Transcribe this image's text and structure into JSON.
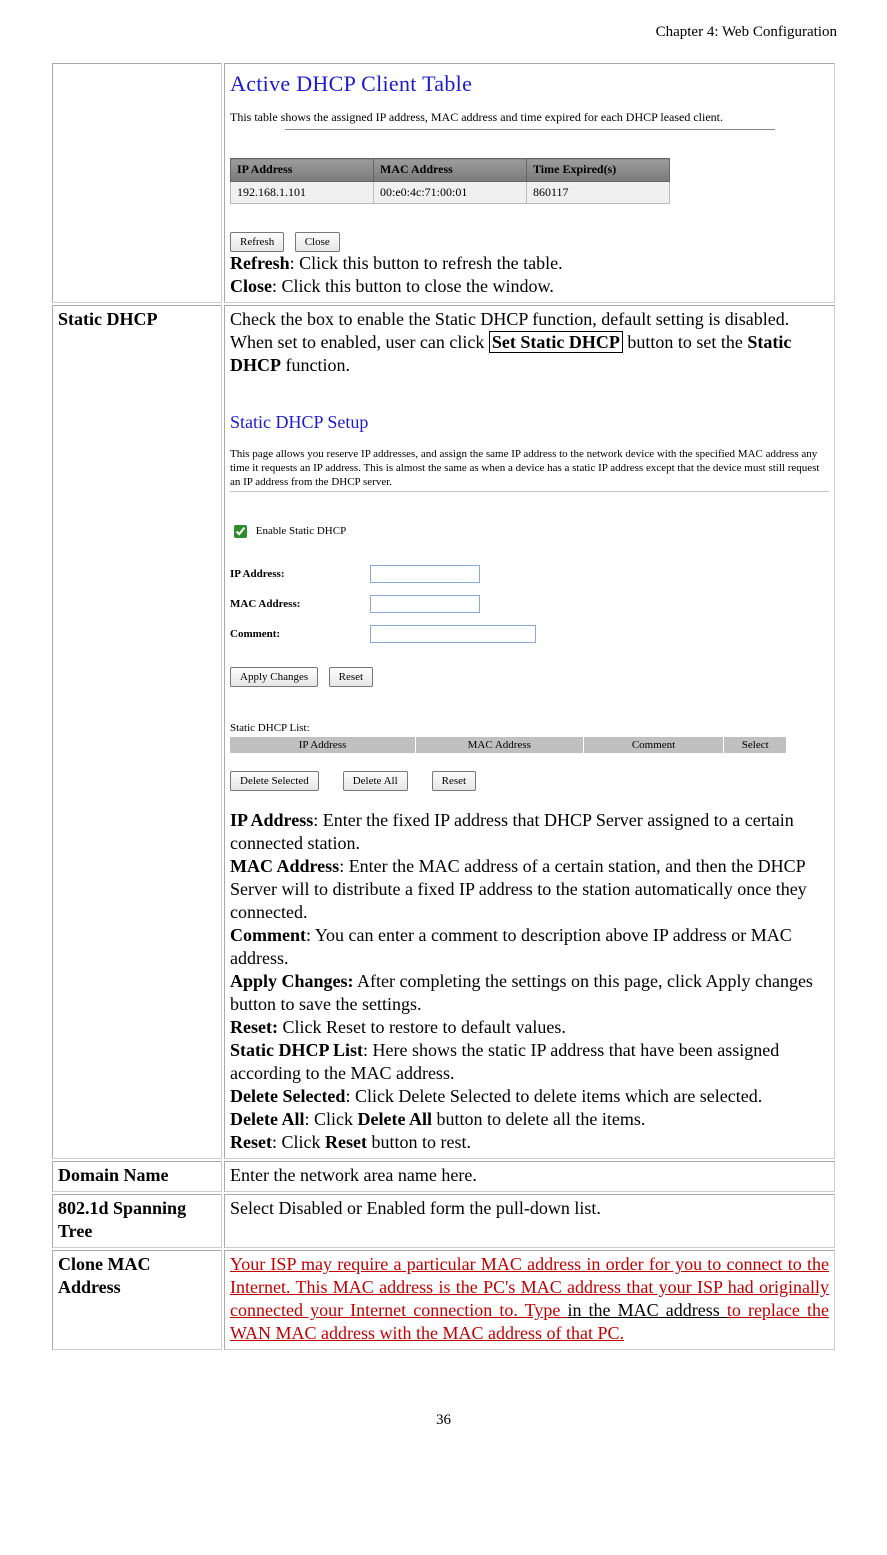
{
  "chapter_header": "Chapter 4: Web Configuration",
  "page_number": "36",
  "row_active": {
    "screenshot": {
      "title": "Active DHCP Client Table",
      "description": "This table shows the assigned IP address, MAC address and time expired for each DHCP leased client.",
      "headers": {
        "ip": "IP Address",
        "mac": "MAC Address",
        "time": "Time Expired(s)"
      },
      "data": {
        "ip": "192.168.1.101",
        "mac": "00:e0:4c:71:00:01",
        "time": "860117"
      },
      "btn_refresh": "Refresh",
      "btn_close": "Close"
    },
    "desc_refresh_b": "Refresh",
    "desc_refresh": ": Click this button to refresh the table.",
    "desc_close_b": "Close",
    "desc_close": ": Click this button to close the window."
  },
  "row_static": {
    "label": "Static DHCP",
    "intro_1": "Check the box to enable the Static DHCP function, default setting is disabled. When set to enabled, user can click ",
    "intro_box": "Set Static DHCP",
    "intro_2": " button to set the ",
    "intro_b": "Static DHCP",
    "intro_3": " function.",
    "screenshot": {
      "title": "Static DHCP Setup",
      "description": "This page allows you reserve IP addresses, and assign the same IP address to the network device with the specified MAC address any time it requests an IP address. This is almost the same as when a device has a static IP address except that the device must still request an IP address from the DHCP server.",
      "enable_label": "Enable Static DHCP",
      "fields": {
        "ip": "IP Address:",
        "mac": "MAC Address:",
        "comment": "Comment:"
      },
      "btn_apply": "Apply Changes",
      "btn_reset": "Reset",
      "list_label": "Static DHCP List:",
      "list_headers": {
        "ip": "IP Address",
        "mac": "MAC Address",
        "cmt": "Comment",
        "sel": "Select"
      },
      "btn_delete_selected": "Delete Selected",
      "btn_delete_all": "Delete All",
      "btn_reset2": "Reset"
    },
    "desc_ip_b": "IP Address",
    "desc_ip": ": Enter the fixed IP address that DHCP Server assigned to a certain connected station.",
    "desc_mac_b": "MAC Address",
    "desc_mac": ": Enter the MAC address of a certain station, and then the DHCP Server will to distribute a fixed IP address to the station automatically once they connected.",
    "desc_cmt_b": "Comment",
    "desc_cmt": ": You can enter a comment to description above IP address or MAC address.",
    "desc_apply_b": "Apply Changes:",
    "desc_apply": " After completing the settings on this page, click Apply changes button to save the settings.",
    "desc_reset_b": "Reset:",
    "desc_reset": " Click Reset to restore to default values.",
    "desc_list_b": "Static DHCP List",
    "desc_list": ": Here shows the static IP address that have been assigned according to the MAC address.",
    "desc_ds_b": "Delete Selected",
    "desc_ds": ": Click Delete Selected to delete items which are selected.",
    "desc_da_b": "Delete All",
    "desc_da_1": ": Click ",
    "desc_da_bb": "Delete All",
    "desc_da_2": " button to delete all the items.",
    "desc_r2_b": "Reset",
    "desc_r2_1": ": Click ",
    "desc_r2_bb": "Reset",
    "desc_r2_2": " button to rest."
  },
  "row_domain": {
    "label": "Domain Name",
    "text": "Enter the network area name here."
  },
  "row_spanning": {
    "label": "802.1d Spanning Tree",
    "text": "Select Disabled or Enabled form the pull-down list."
  },
  "row_clone": {
    "label": "Clone MAC Address",
    "p1": "Your ISP may require a particular MAC address in order for you to connect to the Internet. This MAC address is the PC's MAC address that your ISP had originally connected your Internet connection to. Type ",
    "p_black": "in the MAC address ",
    "p2": "to replace the WAN MAC address with the MAC address of that PC."
  }
}
